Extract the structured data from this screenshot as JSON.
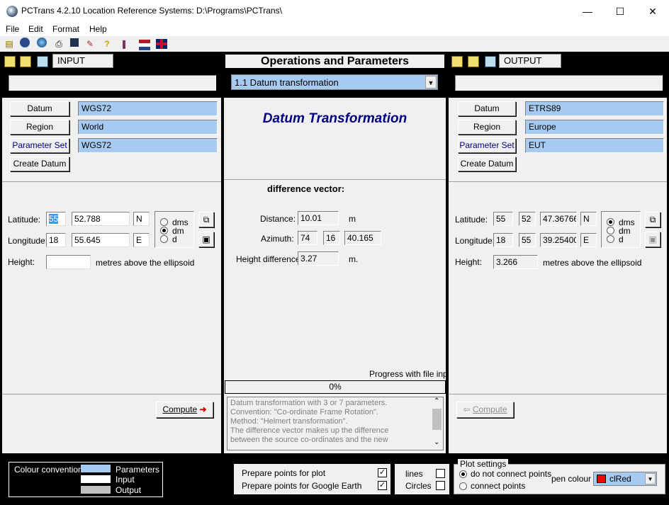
{
  "window": {
    "title": "PCTrans 4.2.10    Location Reference Systems: D:\\Programs\\PCTrans\\",
    "minimize": "—",
    "maximize": "☐",
    "close": "✕"
  },
  "menu": [
    "File",
    "Edit",
    "Format",
    "Help"
  ],
  "input": {
    "tab_label": "INPUT",
    "datum_label": "Datum",
    "datum_value": "WGS72",
    "region_label": "Region",
    "region_value": "World",
    "paramset_label": "Parameter Set",
    "paramset_value": "WGS72",
    "create_datum_label": "Create Datum",
    "latitude_label": "Latitude:",
    "lat_deg": "55",
    "lat_min": "52.788",
    "lat_hemi": "N",
    "longitude_label": "Longitude:",
    "lon_deg": "18",
    "lon_min": "55.645",
    "lon_hemi": "E",
    "format_options": [
      "dms",
      "dm",
      "d"
    ],
    "format_selected": "dm",
    "height_label": "Height:",
    "height_value": "",
    "height_unit": "metres above the ellipsoid",
    "compute_label": "Compute"
  },
  "ops": {
    "header": "Operations and Parameters",
    "operation": "1.1   Datum transformation",
    "subtitle": "Datum Transformation",
    "diff_title": "difference vector:",
    "distance_label": "Distance:",
    "distance_value": "10.01",
    "distance_unit": "m",
    "azimuth_label": "Azimuth:",
    "az_deg": "74",
    "az_min": "16",
    "az_sec": "40.165",
    "height_diff_label": "Height difference:",
    "height_diff_value": "3.27",
    "height_diff_unit": "m.",
    "progress_label": "Progress with file input",
    "progress_text": "0%",
    "description": "Datum transformation with 3 or 7 parameters.\nConvention: \"Co-ordinate Frame Rotation\".\nMethod: \"Helmert transformation\".\nThe difference vector makes up the difference\nbetween the source co-ordinates and the new"
  },
  "output": {
    "tab_label": "OUTPUT",
    "datum_label": "Datum",
    "datum_value": "ETRS89",
    "region_label": "Region",
    "region_value": "Europe",
    "paramset_label": "Parameter Set",
    "paramset_value": "EUT",
    "create_datum_label": "Create Datum",
    "latitude_label": "Latitude:",
    "lat_deg": "55",
    "lat_min": "52",
    "lat_sec": "47.36766",
    "lat_hemi": "N",
    "longitude_label": "Longitude:",
    "lon_deg": "18",
    "lon_min": "55",
    "lon_sec": "39.25400",
    "lon_hemi": "E",
    "format_options": [
      "dms",
      "dm",
      "d"
    ],
    "format_selected": "dms",
    "height_label": "Height:",
    "height_value": "3.266",
    "height_unit": "metres above the ellipsoid",
    "compute_label": "Compute"
  },
  "footer": {
    "colour_title": "Colour conventions",
    "legend": [
      {
        "label": "Parameters",
        "color": "#a6caf0"
      },
      {
        "label": "Input",
        "color": "#ffffff"
      },
      {
        "label": "Output",
        "color": "#c0c0c0"
      }
    ],
    "prepare_plot": "Prepare points for plot",
    "prepare_ge": "Prepare points for Google Earth",
    "lines": "lines",
    "circles": "Circles",
    "plot_settings": "Plot settings",
    "no_connect": "do not connect points",
    "connect": "connect points",
    "pen_colour_label": "pen colour",
    "pen_colour_value": "clRed",
    "pen_colour_swatch": "#ff0000"
  }
}
